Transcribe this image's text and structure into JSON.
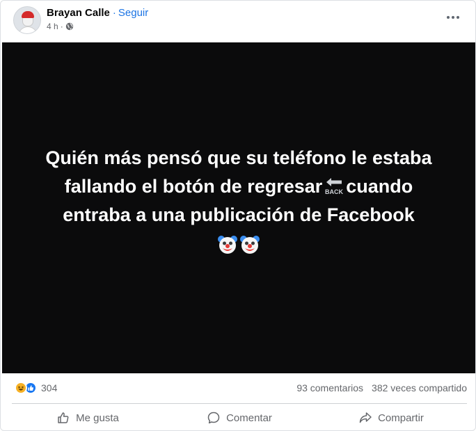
{
  "post": {
    "author": "Brayan Calle",
    "separator": "·",
    "follow_label": "Seguir",
    "time": "4 h",
    "time_separator": "·",
    "privacy_icon": "globe-icon",
    "menu_icon": "more-options-icon"
  },
  "media": {
    "background_color": "#0b0b0c",
    "text_part1": "Quién más pensó que su teléfono le estaba fallando el botón de regresar",
    "back_emoji_label": "BACK",
    "text_part2": "cuando entraba a una publicación de Facebook",
    "trailing_emoji": "clown-face-icon"
  },
  "stats": {
    "reaction_icons": [
      "haha-reaction-icon",
      "like-reaction-icon"
    ],
    "reaction_count": "304",
    "comments": "93 comentarios",
    "shares": "382 veces compartido"
  },
  "actions": {
    "like": "Me gusta",
    "comment": "Comentar",
    "share": "Compartir"
  },
  "colors": {
    "link_blue": "#1b74e4",
    "like_blue": "#1877f2",
    "haha_yellow": "#f7b125",
    "secondary_text": "#65676b"
  }
}
